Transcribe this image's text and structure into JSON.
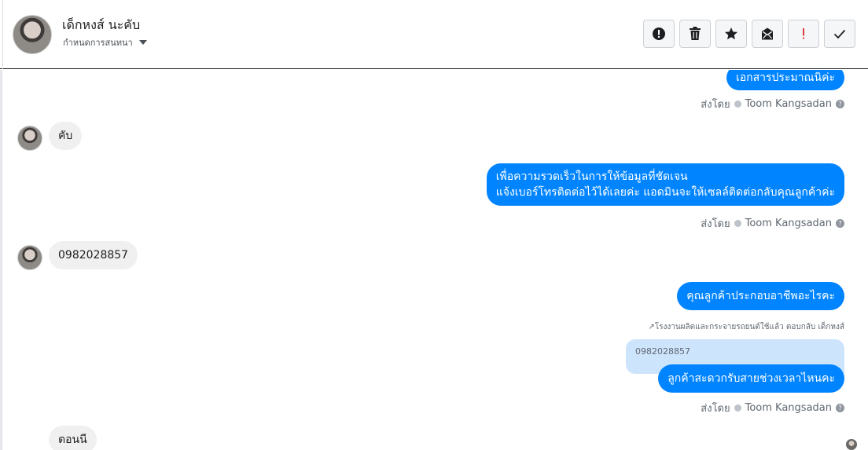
{
  "header": {
    "contact_name": "เด็กหงส์ นะคับ",
    "assign_label": "กำหนดการสนทนา",
    "actions": [
      {
        "name": "alert-circle-icon"
      },
      {
        "name": "trash-icon"
      },
      {
        "name": "star-icon"
      },
      {
        "name": "envelope-unread-icon"
      },
      {
        "name": "exclamation-icon"
      },
      {
        "name": "checkmark-icon"
      }
    ]
  },
  "messages": {
    "m1_text": "เอกสารประมาณนิค่ะ",
    "m1_sentby_prefix": "ส่งโดย",
    "m1_sender": "Toom Kangsadan",
    "m2_text": "คับ",
    "m3_line1": "เพื่อความรวดเร็วในการให้ข้อมูลที่ชัดเจน",
    "m3_line2": "แจ้งเบอร์โทรติดต่อไว้ได้เลยค่ะ แอดมินจะให้เซลล์ติดต่อกลับคุณลูกค้าค่ะ",
    "m3_sentby_prefix": "ส่งโดย",
    "m3_sender": "Toom Kangsadan",
    "m4_text": "0982028857",
    "m5_text": "คุณลูกค้าประกอบอาชีพอะไรคะ",
    "m6_reply_note": "โรงงานผลิตและกระจายรถยนต์ใช้แล้ว ตอบกลับ เด็กหงส์",
    "m6_quoted": "0982028857",
    "m6_text": "ลูกค้าสะดวกรับสายช่วงเวลาไหนคะ",
    "m6_sentby_prefix": "ส่งโดย",
    "m6_sender": "Toom Kangsadan",
    "m7_text": "ตอนนี"
  },
  "colors": {
    "outgoing_bubble": "#0084ff",
    "incoming_bubble": "#f1f0f0",
    "quoted_bubble": "#cde4fd"
  }
}
